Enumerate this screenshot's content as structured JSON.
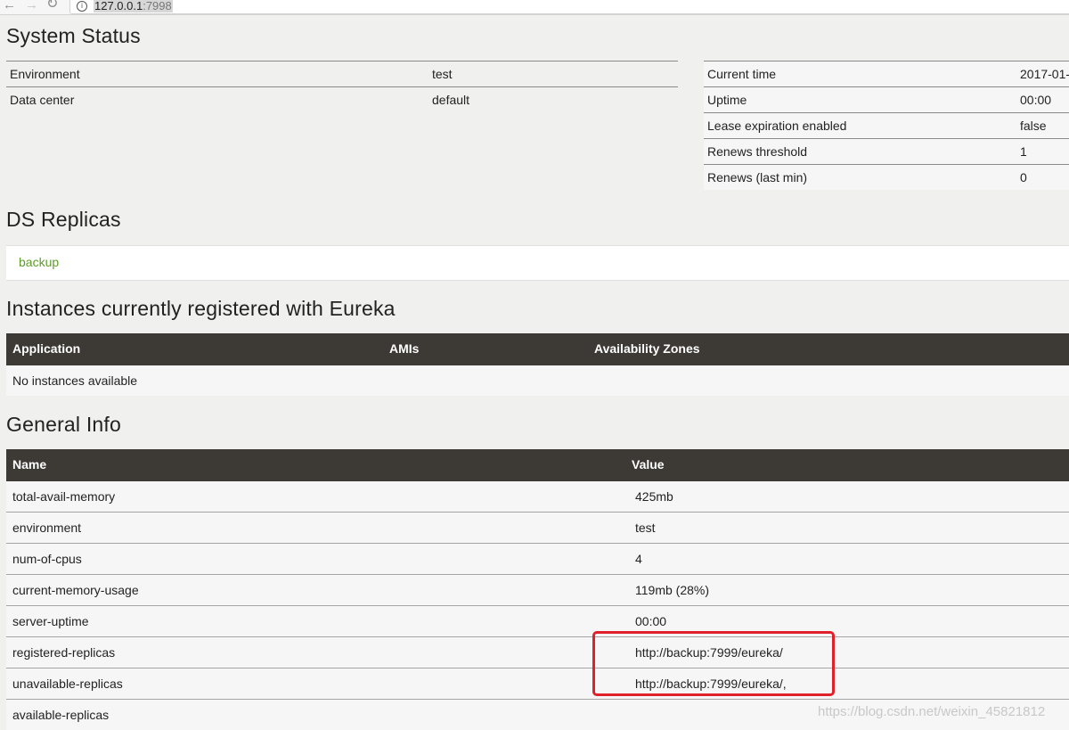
{
  "browser": {
    "url_host": "127.0.0.1",
    "url_port": ":7998",
    "back_icon": "←",
    "forward_icon": "→",
    "reload_icon": "C",
    "info_icon": "i"
  },
  "system_status": {
    "title": "System Status",
    "left": [
      {
        "label": "Environment",
        "value": "test"
      },
      {
        "label": "Data center",
        "value": "default"
      }
    ],
    "right": [
      {
        "label": "Current time",
        "value": "2017-01-"
      },
      {
        "label": "Uptime",
        "value": "00:00"
      },
      {
        "label": "Lease expiration enabled",
        "value": "false"
      },
      {
        "label": "Renews threshold",
        "value": "1"
      },
      {
        "label": "Renews (last min)",
        "value": "0"
      }
    ]
  },
  "ds_replicas": {
    "title": "DS Replicas",
    "link": "backup"
  },
  "instances": {
    "title": "Instances currently registered with Eureka",
    "headers": [
      "Application",
      "AMIs",
      "Availability Zones"
    ],
    "empty_text": "No instances available"
  },
  "general_info": {
    "title": "General Info",
    "headers": [
      "Name",
      "Value"
    ],
    "rows": [
      {
        "name": "total-avail-memory",
        "value": "425mb"
      },
      {
        "name": "environment",
        "value": "test"
      },
      {
        "name": "num-of-cpus",
        "value": "4"
      },
      {
        "name": "current-memory-usage",
        "value": "119mb (28%)"
      },
      {
        "name": "server-uptime",
        "value": "00:00"
      },
      {
        "name": "registered-replicas",
        "value": "http://backup:7999/eureka/"
      },
      {
        "name": "unavailable-replicas",
        "value": "http://backup:7999/eureka/,"
      },
      {
        "name": "available-replicas",
        "value": ""
      }
    ]
  },
  "watermark": "https://blog.csdn.net/weixin_45821812",
  "colors": {
    "header_bg": "#3d3935",
    "link": "#5e9b2a",
    "highlight": "#e0202a",
    "page_bg": "#f0f0ef"
  }
}
